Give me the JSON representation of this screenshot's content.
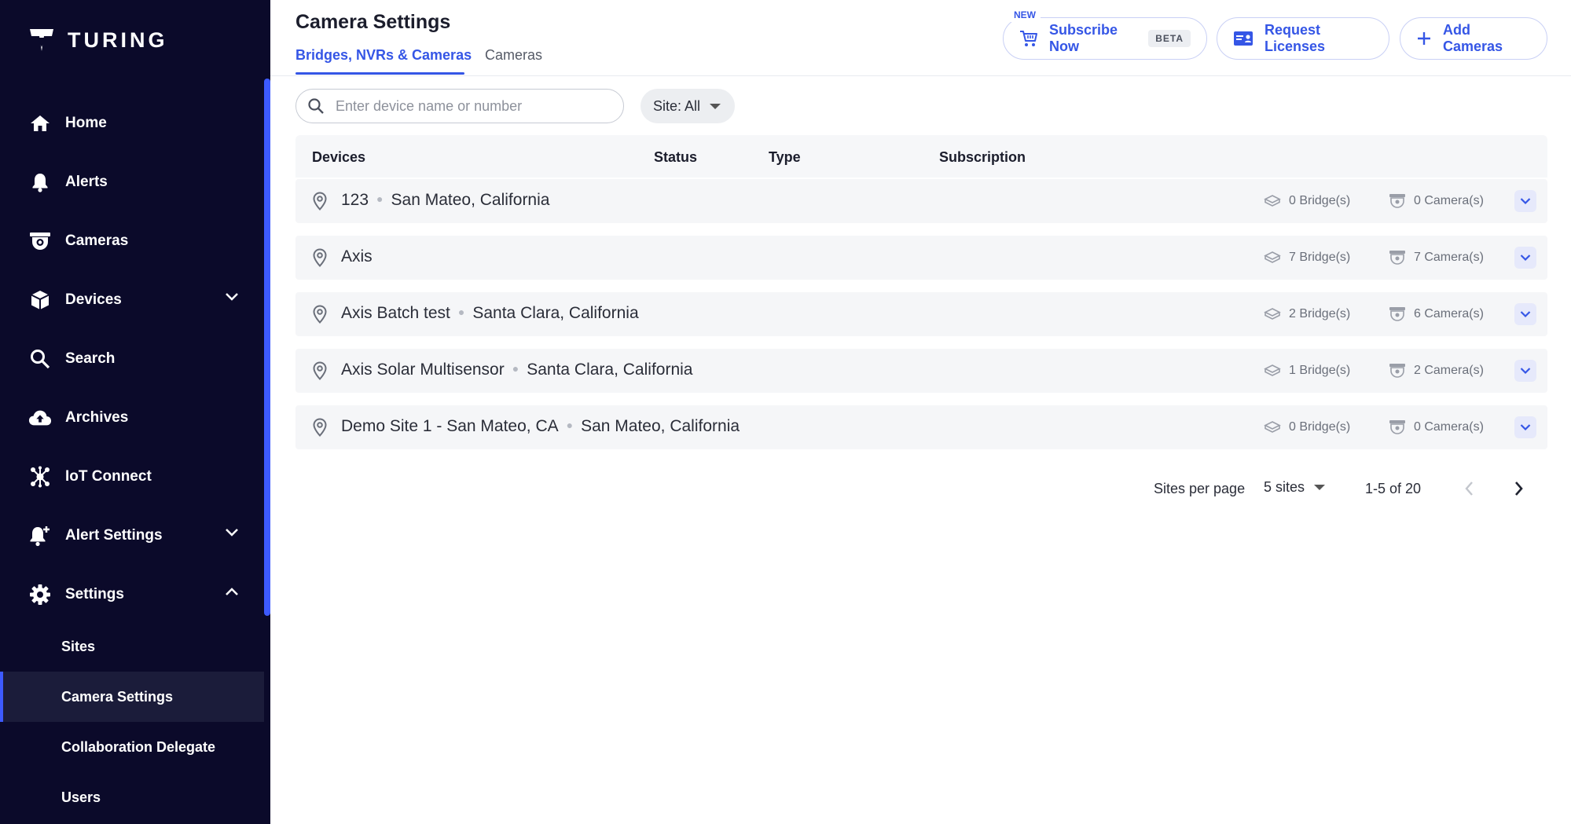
{
  "brand": {
    "name": "TURING"
  },
  "sidebar": {
    "items": [
      {
        "label": "Home",
        "icon": "home-icon"
      },
      {
        "label": "Alerts",
        "icon": "bell-icon"
      },
      {
        "label": "Cameras",
        "icon": "camera-icon"
      },
      {
        "label": "Devices",
        "icon": "cube-icon",
        "expandable": true,
        "expanded": false
      },
      {
        "label": "Search",
        "icon": "search-icon"
      },
      {
        "label": "Archives",
        "icon": "cloud-upload-icon"
      },
      {
        "label": "IoT Connect",
        "icon": "hub-icon"
      },
      {
        "label": "Alert Settings",
        "icon": "bell-plus-icon",
        "expandable": true,
        "expanded": false
      },
      {
        "label": "Settings",
        "icon": "gear-icon",
        "expandable": true,
        "expanded": true
      }
    ],
    "sub_items": [
      {
        "label": "Sites",
        "active": false
      },
      {
        "label": "Camera Settings",
        "active": true
      },
      {
        "label": "Collaboration Delegate",
        "active": false
      },
      {
        "label": "Users",
        "active": false
      }
    ]
  },
  "header": {
    "title": "Camera Settings",
    "tabs": [
      {
        "label": "Bridges, NVRs & Cameras",
        "active": true
      },
      {
        "label": "Cameras",
        "active": false
      }
    ],
    "buttons": {
      "subscribe": {
        "label": "Subscribe Now",
        "badge": "BETA",
        "tag": "NEW"
      },
      "licenses": {
        "label": "Request Licenses"
      },
      "add": {
        "label": "Add Cameras"
      }
    }
  },
  "filters": {
    "search_placeholder": "Enter device name or number",
    "site_filter": "Site: All"
  },
  "table": {
    "columns": [
      "Devices",
      "Status",
      "Type",
      "Subscription"
    ],
    "rows": [
      {
        "name": "123",
        "location": "San Mateo, California",
        "bridges": "0 Bridge(s)",
        "cameras": "0 Camera(s)"
      },
      {
        "name": "Axis",
        "location": "",
        "bridges": "7 Bridge(s)",
        "cameras": "7 Camera(s)"
      },
      {
        "name": "Axis Batch test",
        "location": "Santa Clara, California",
        "bridges": "2 Bridge(s)",
        "cameras": "6 Camera(s)"
      },
      {
        "name": "Axis Solar Multisensor",
        "location": "Santa Clara, California",
        "bridges": "1 Bridge(s)",
        "cameras": "2 Camera(s)"
      },
      {
        "name": "Demo Site 1 - San Mateo, CA",
        "location": "San Mateo, California",
        "bridges": "0 Bridge(s)",
        "cameras": "0 Camera(s)"
      }
    ]
  },
  "pagination": {
    "label": "Sites per page",
    "per_page": "5 sites",
    "range": "1-5 of 20"
  },
  "colors": {
    "sidebar_bg": "#0b0a2a",
    "accent": "#3556e6",
    "row_bg": "#f5f6f8"
  }
}
